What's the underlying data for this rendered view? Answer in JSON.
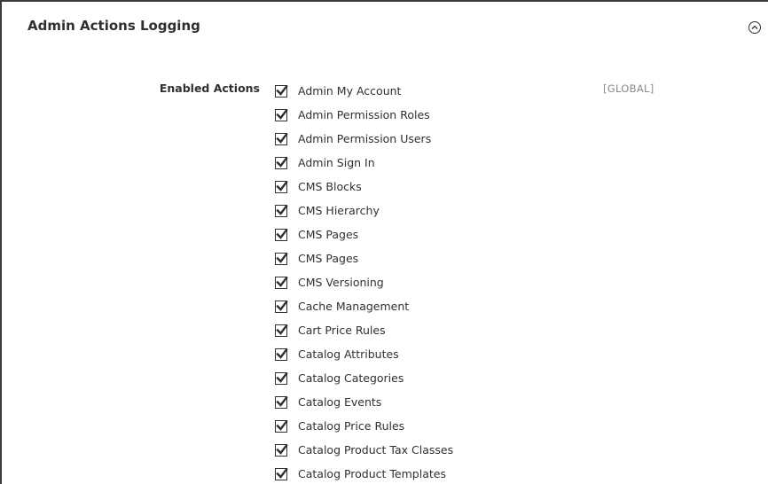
{
  "section": {
    "title": "Admin Actions Logging",
    "toggle_icon": "collapse-circle-chevron-up-icon"
  },
  "field": {
    "label": "Enabled Actions",
    "scope": "[GLOBAL]"
  },
  "actions": [
    {
      "label": "Admin My Account",
      "checked": true
    },
    {
      "label": "Admin Permission Roles",
      "checked": true
    },
    {
      "label": "Admin Permission Users",
      "checked": true
    },
    {
      "label": "Admin Sign In",
      "checked": true
    },
    {
      "label": "CMS Blocks",
      "checked": true
    },
    {
      "label": "CMS Hierarchy",
      "checked": true
    },
    {
      "label": "CMS Pages",
      "checked": true
    },
    {
      "label": "CMS Pages",
      "checked": true
    },
    {
      "label": "CMS Versioning",
      "checked": true
    },
    {
      "label": "Cache Management",
      "checked": true
    },
    {
      "label": "Cart Price Rules",
      "checked": true
    },
    {
      "label": "Catalog Attributes",
      "checked": true
    },
    {
      "label": "Catalog Categories",
      "checked": true
    },
    {
      "label": "Catalog Events",
      "checked": true
    },
    {
      "label": "Catalog Price Rules",
      "checked": true
    },
    {
      "label": "Catalog Product Tax Classes",
      "checked": true
    },
    {
      "label": "Catalog Product Templates",
      "checked": true
    }
  ],
  "colors": {
    "text": "#303030",
    "scope_text": "#8a8a8a",
    "frame_border": "#3a3a3a"
  }
}
